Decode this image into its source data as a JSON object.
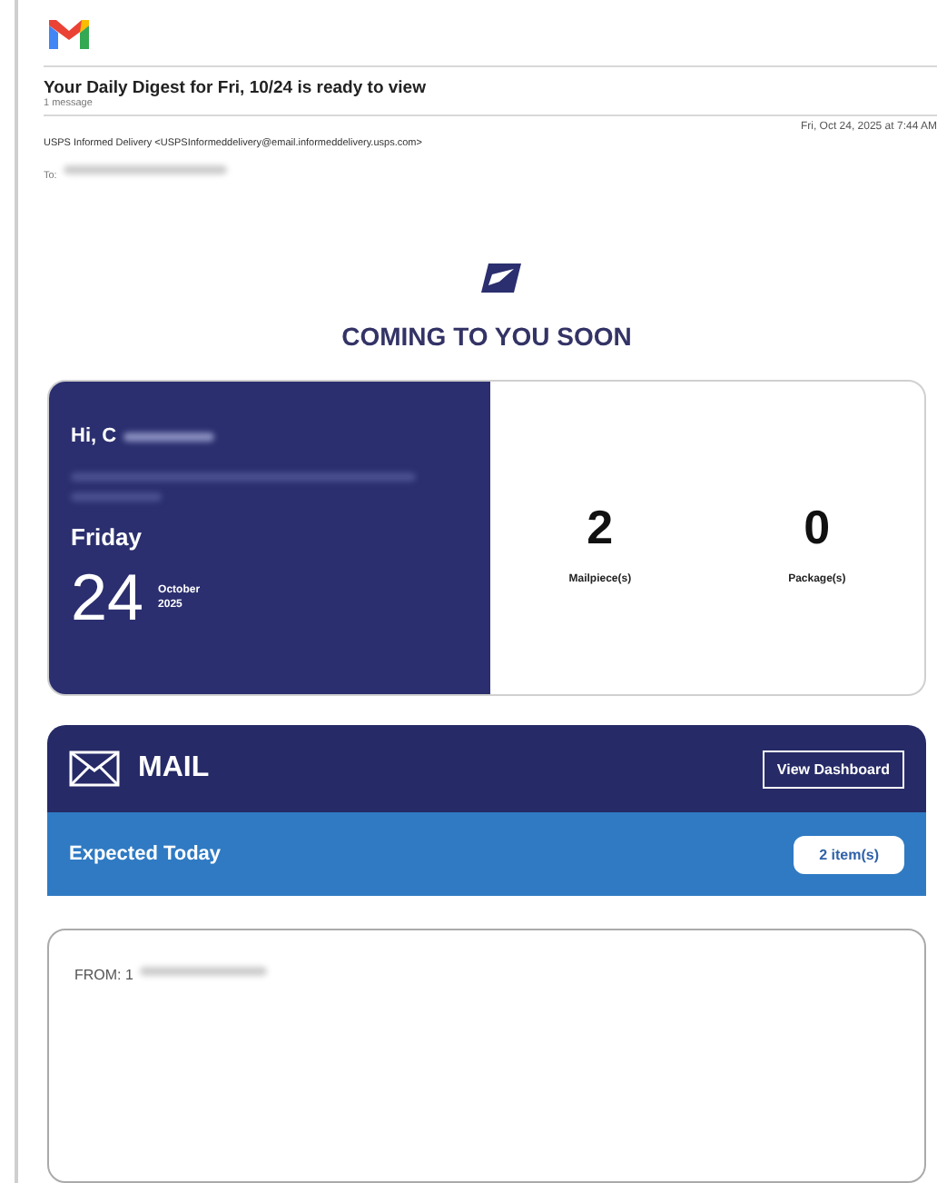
{
  "email": {
    "subject": "Your Daily Digest for Fri, 10/24 is ready to view",
    "message_count": "1 message",
    "sender": "USPS Informed Delivery <USPSInformeddelivery@email.informeddelivery.usps.com>",
    "date": "Fri, Oct 24, 2025 at 7:44 AM",
    "to_label": "To:"
  },
  "heading": "COMING TO YOU SOON",
  "summary": {
    "greeting": "Hi, C",
    "day": "Friday",
    "date_number": "24",
    "month": "October",
    "year": "2025",
    "counts": [
      {
        "value": "2",
        "label": "Mailpiece(s)"
      },
      {
        "value": "0",
        "label": "Package(s)"
      }
    ]
  },
  "mail": {
    "title": "MAIL",
    "dashboard_button": "View Dashboard",
    "expected_label": "Expected Today",
    "item_count": "2 item(s)"
  },
  "from_card": {
    "label": "FROM: 1"
  }
}
